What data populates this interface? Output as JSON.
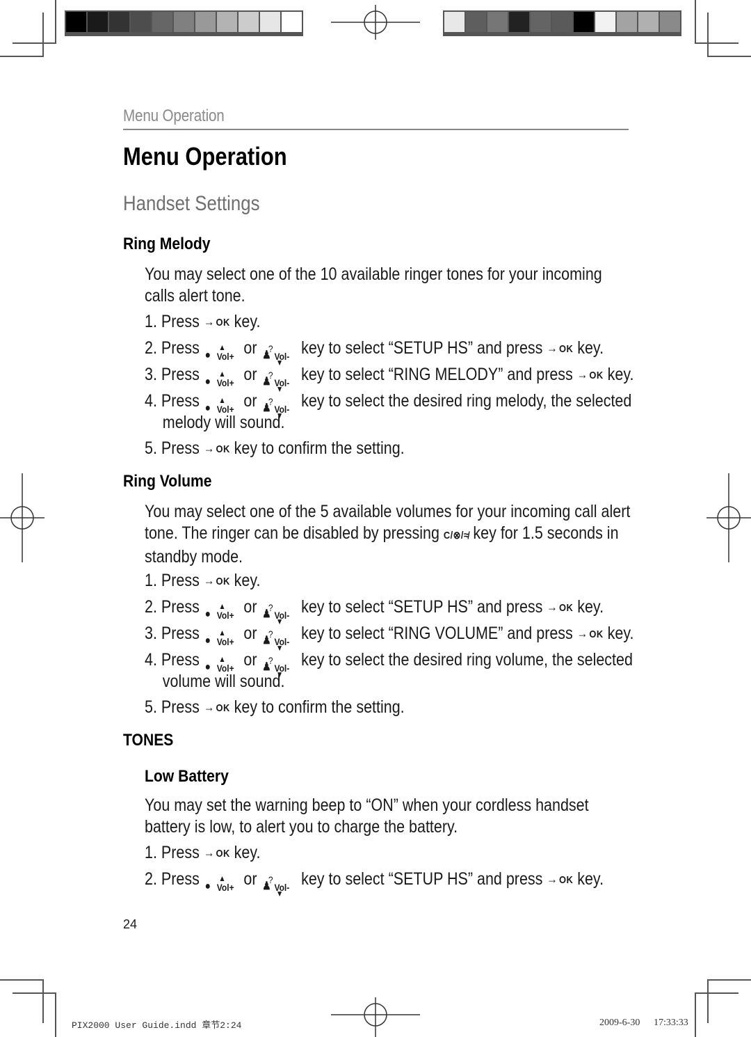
{
  "color_bars": {
    "left": [
      "#000000",
      "#1a1a1a",
      "#333333",
      "#4d4d4d",
      "#666666",
      "#808080",
      "#999999",
      "#b3b3b3",
      "#cccccc",
      "#e6e6e6",
      "#ffffff"
    ],
    "right": [
      "#e8e8e8",
      "#5e5e5e",
      "#767676",
      "#222222",
      "#646464",
      "#5a5a5a",
      "#000000",
      "#f2f2f2",
      "#a3a3a3",
      "#b0b0b0",
      "#8a8a8a"
    ]
  },
  "running_head": "Menu Operation",
  "title": "Menu Operation",
  "subtitle": "Handset Settings",
  "icons": {
    "ok_key": "OK",
    "ok_arrow": "→",
    "vol_up_label": "Vol+",
    "vol_down_label": "Vol-",
    "up_triangle": "▲",
    "down_triangle": "▼",
    "question": "?",
    "c_key": "C/⊗/≉"
  },
  "words": {
    "or": "or"
  },
  "sections": {
    "ring_melody": {
      "heading": "Ring Melody",
      "intro": "You may select one of the 10 available ringer tones for your incoming calls alert tone.",
      "steps": [
        {
          "num": "1. Press",
          "after": "key."
        },
        {
          "num": "2. Press",
          "after": "key to select “SETUP HS” and press",
          "end": "key."
        },
        {
          "num": "3. Press",
          "after": "key to select “RING MELODY” and press",
          "end": "key."
        },
        {
          "num": "4. Press",
          "after": "key to select the desired ring melody, the selected",
          "cont": "melody will sound."
        },
        {
          "num": "5. Press",
          "after": "key to confirm the setting."
        }
      ]
    },
    "ring_volume": {
      "heading": "Ring Volume",
      "intro_a": "You may select one of the 5 available volumes for your incoming call alert",
      "intro_b": "tone. The ringer can be disabled by pressing",
      "intro_c": "key for 1.5 seconds in",
      "intro_d": "standby mode.",
      "steps": [
        {
          "num": "1. Press",
          "after": "key."
        },
        {
          "num": "2. Press",
          "after": "key to select “SETUP HS” and press",
          "end": "key."
        },
        {
          "num": "3. Press",
          "after": "key to select “RING VOLUME” and press",
          "end": "key."
        },
        {
          "num": "4. Press",
          "after": "key to select the desired ring volume, the selected",
          "cont": "volume will sound."
        },
        {
          "num": "5. Press",
          "after": "key to confirm the setting."
        }
      ]
    },
    "tones": {
      "heading": "TONES",
      "low_battery": {
        "heading": "Low Battery",
        "intro": "You may set the warning beep to “ON” when your cordless handset battery is low, to alert you to charge the battery.",
        "steps": [
          {
            "num": "1. Press",
            "after": "key."
          },
          {
            "num": "2. Press",
            "after": "key to select “SETUP HS” and press",
            "end": "key."
          }
        ]
      }
    }
  },
  "page_number": "24",
  "slug": {
    "file": "PIX2000 User Guide.indd   章节2:24",
    "date": "2009-6-30",
    "time": "17:33:33"
  }
}
